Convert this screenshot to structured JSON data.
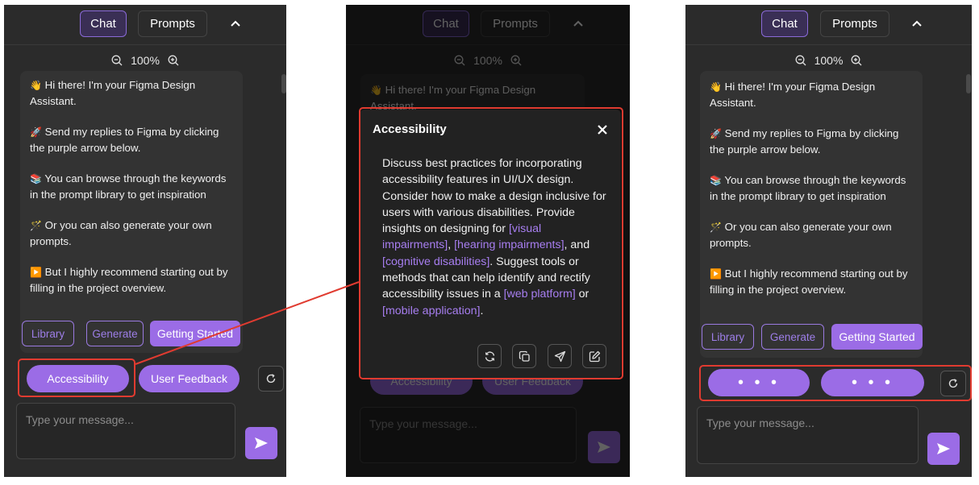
{
  "header": {
    "chat_tab": "Chat",
    "prompts_tab": "Prompts",
    "collapse_icon": "chevron-up-icon"
  },
  "zoom": {
    "level": "100%",
    "zoom_out_icon": "zoom-out-icon",
    "zoom_in_icon": "zoom-in-icon"
  },
  "messages": {
    "greeting_emoji": "👋",
    "greeting": "Hi there! I'm your Figma Design Assistant.",
    "greeting_line1": "Hi there! I'm your Figma Design",
    "greeting_line2": "Assistant.",
    "send_emoji": "🚀",
    "send_line1": "Send my replies to Figma by clicking",
    "send_line2": "the purple arrow below.",
    "browse_emoji": "📚",
    "browse_line1": "You can browse through the keywords",
    "browse_line2": "in the prompt library to get inspiration",
    "generate_emoji": "🪄",
    "generate_line1": "Or you can also generate your own",
    "generate_line2": "prompts.",
    "recommend_emoji": "▶️",
    "recommend_line1": "But I highly recommend starting out by",
    "recommend_line2": "filling in the project overview."
  },
  "actions": {
    "library": "Library",
    "generate": "Generate",
    "getting_started": "Getting Started"
  },
  "suggestions": {
    "first": "Accessibility",
    "second": "User Feedback",
    "loading": "• • •",
    "refresh_icon": "refresh-icon"
  },
  "input": {
    "placeholder": "Type your message...",
    "send_icon": "send-arrow-icon"
  },
  "modal": {
    "title": "Accessibility",
    "close_icon": "close-icon",
    "body_part1": "Discuss best practices for incorporating accessibility features in UI/UX design. Consider how to make a design inclusive for users with various disabilities. Provide insights on designing for ",
    "kw1": "[visual impairments]",
    "sep1": ", ",
    "kw2": "[hearing impairments]",
    "sep2": ", and ",
    "kw3": "[cognitive disabilities]",
    "body_part2": ". Suggest tools or methods that can help identify and rectify accessibility issues in a ",
    "kw4": "[web platform]",
    "sep3": " or ",
    "kw5": "[mobile application]",
    "end": ".",
    "buttons": [
      "regenerate-icon",
      "copy-icon",
      "send-icon",
      "edit-icon"
    ]
  },
  "colors": {
    "accent": "#9b6ce6",
    "highlight": "#e03b30",
    "panel": "#2b2b2b"
  }
}
